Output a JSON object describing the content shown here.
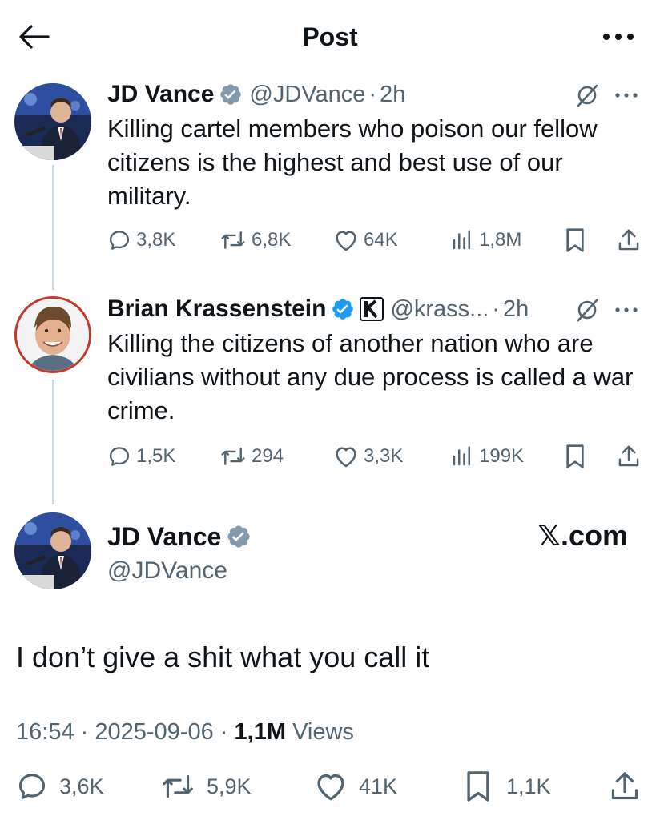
{
  "header": {
    "title": "Post"
  },
  "reply_1": {
    "name": "JD Vance",
    "handle": "@JDVance",
    "sep": "·",
    "time": "2h",
    "text": "Killing cartel members who poison our fellow citizens is the highest and best use of our military.",
    "replies": "3,8K",
    "reposts": "6,8K",
    "likes": "64K",
    "views": "1,8M"
  },
  "reply_2": {
    "name": "Brian Krassenstein",
    "handle": "@krass...",
    "sep": "·",
    "time": "2h",
    "text": "Killing the citizens of another nation who are civilians without any due process is called a war crime.",
    "replies": "1,5K",
    "reposts": "294",
    "likes": "3,3K",
    "views": "199K"
  },
  "main_post": {
    "name": "JD Vance",
    "handle": "@JDVance",
    "watermark": "𝕏.com",
    "text": "I don’t give a shit what you call it",
    "time": "16:54",
    "sep1": "·",
    "date": "2025-09-06",
    "sep2": "·",
    "views_count": "1,1M",
    "views_label": "Views",
    "replies": "3,6K",
    "reposts": "5,9K",
    "likes": "41K",
    "bookmarks": "1,1K"
  },
  "colors": {
    "text": "#0f1419",
    "secondary": "#536471",
    "verified_gray": "#829aab",
    "verified_blue": "#1d9bf0",
    "thread_line": "#cfd9de"
  },
  "icons": [
    "back-arrow-icon",
    "more-icon",
    "verified-gray-icon",
    "verified-blue-icon",
    "grok-icon",
    "reply-icon",
    "repost-icon",
    "like-icon",
    "views-icon",
    "bookmark-icon",
    "share-icon"
  ]
}
